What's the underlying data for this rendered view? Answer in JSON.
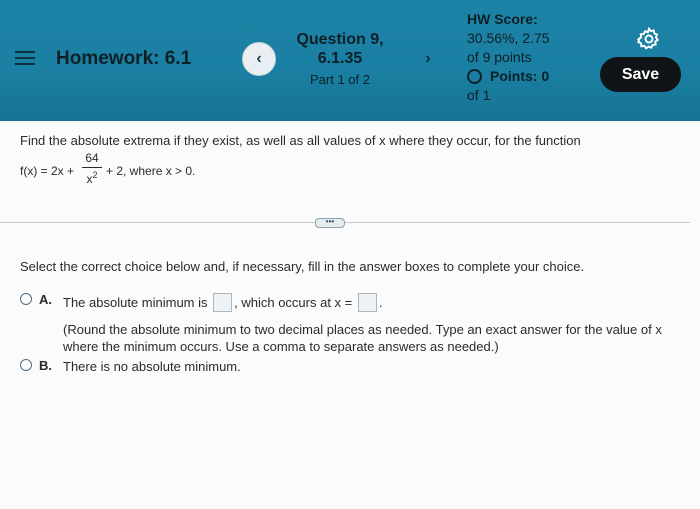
{
  "header": {
    "title": "Homework: 6.1",
    "prev_label": "‹",
    "next_label": "›",
    "question_title": "Question 9,",
    "question_number": "6.1.35",
    "part": "Part 1 of 2",
    "score_label": "HW Score:",
    "score_value": "30.56%, 2.75",
    "score_of": "of 9 points",
    "points_label": "Points: 0",
    "points_of": "of 1",
    "save_label": "Save"
  },
  "question": {
    "prompt": "Find the absolute extrema if they exist, as well as all values of x where they occur, for the function",
    "function_lhs": "f(x) = 2x +",
    "fraction_numerator": "64",
    "fraction_denominator": "x",
    "fraction_exponent": "2",
    "function_rhs": "+ 2, where x > 0.",
    "more_label": "•••"
  },
  "answer": {
    "instruction": "Select the correct choice below and, if necessary, fill in the answer boxes to complete your choice.",
    "choice_a": {
      "letter": "A.",
      "text_before": "The absolute minimum is",
      "text_middle": ", which occurs at x =",
      "text_after": ".",
      "note": "(Round the absolute minimum to two decimal places as needed. Type an exact answer for the value of x where the minimum occurs. Use a comma to separate answers as needed.)"
    },
    "choice_b": {
      "letter": "B.",
      "text": "There is no absolute minimum."
    }
  },
  "colors": {
    "header_bg": "#1a7fa2",
    "save_bg": "#111417",
    "radio_border": "#4d6d8c"
  },
  "icons": [
    "hamburger-menu-icon",
    "chevron-left-icon",
    "chevron-right-icon",
    "gear-icon",
    "radio-empty-icon"
  ]
}
